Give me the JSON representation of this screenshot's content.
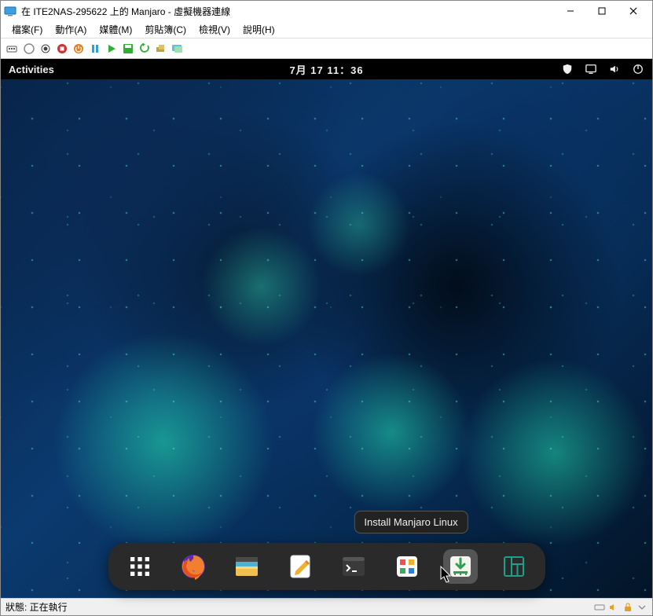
{
  "window": {
    "title": "在 ITE2NAS-295622 上的 Manjaro - 虛擬機器連線"
  },
  "menu": [
    "檔案(F)",
    "動作(A)",
    "媒體(M)",
    "剪貼簿(C)",
    "檢視(V)",
    "說明(H)"
  ],
  "vm_toolbar_icons": [
    "ctrl-alt-del-icon",
    "connect-icon",
    "record-icon",
    "stop-icon",
    "power-off-icon",
    "pause-icon",
    "start-icon",
    "save-icon",
    "revert-icon",
    "checkpoint-icon",
    "enhanced-session-icon"
  ],
  "gnome": {
    "activities": "Activities",
    "clock": "7月 17 11：36"
  },
  "dock_tooltip": "Install Manjaro Linux",
  "dock_items": [
    "apps",
    "firefox",
    "files",
    "text-editor",
    "terminal",
    "software",
    "installer",
    "manjaro-settings"
  ],
  "status": {
    "text": "狀態: 正在執行"
  }
}
